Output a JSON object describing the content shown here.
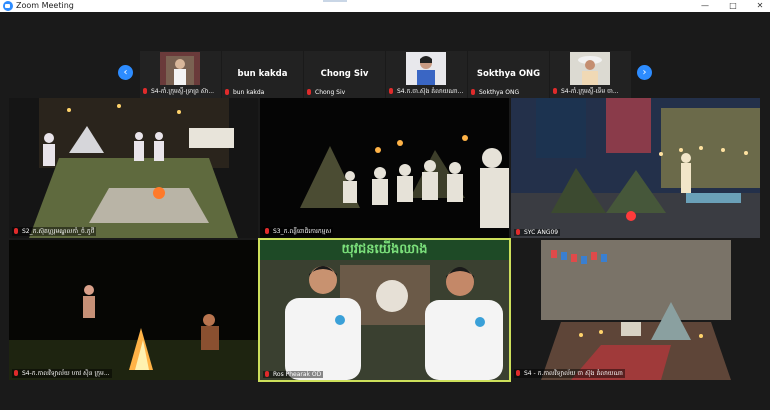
{
  "window": {
    "title": "Zoom Meeting",
    "minimize": "—",
    "maximize": "□",
    "close": "✕"
  },
  "strip": {
    "prev": "‹",
    "next": "›",
    "thumbs": [
      {
        "name": "",
        "label": "S4-កាំ.ក្រុមស្លឹ-ទ្រាព្រ ស៊ា..."
      },
      {
        "name": "bun kakda",
        "label": "bun kakda"
      },
      {
        "name": "Chong Siv",
        "label": "Chong Siv"
      },
      {
        "name": "",
        "label": "S4.ក.ចា.ស៊ុង គំលាយណា..."
      },
      {
        "name": "Sokthya ONG",
        "label": "Sokthya ONG"
      },
      {
        "name": "",
        "label": "S4-កាំ.ក្រុមស្លឹ-ទើម ចា..."
      }
    ]
  },
  "tiles": [
    {
      "label": "S2_ក.ស៊ុតហរ្ណមណ្ឌលកាំ_ចំ.កូថី"
    },
    {
      "label": "S3_ក.ពន្លឺពោធិកោរកម្មស"
    },
    {
      "label": "SYC ANG09"
    },
    {
      "label": "S4-ក.កាលវិទ្យាល័យ ហាវ ស៊ិន ក្រុម..."
    },
    {
      "label": "Ros Phearak OD"
    },
    {
      "label": "S4 - ក.កាលវិទ្យាល័យ ចា ស៊ុង គំលាយណា"
    }
  ],
  "banner": "យុវជនយើងឈាង",
  "colors": {
    "accent": "#2d8cff",
    "active_speaker": "#cde05b",
    "mic_muted": "#e02b2b"
  }
}
